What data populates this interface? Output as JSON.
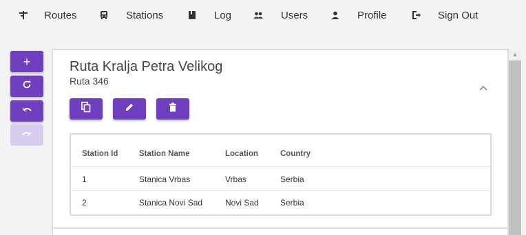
{
  "nav": {
    "routes": "Routes",
    "stations": "Stations",
    "log": "Log",
    "users": "Users",
    "profile": "Profile",
    "sign_out": "Sign Out"
  },
  "toolbar": {
    "add": "+",
    "refresh": "refresh-icon",
    "undo": "undo-icon",
    "redo": "redo-icon",
    "redo_enabled": false
  },
  "route": {
    "title": "Ruta Kralja Petra Velikog",
    "subtitle": "Ruta 346"
  },
  "table": {
    "headers": [
      "Station Id",
      "Station Name",
      "Location",
      "Country"
    ],
    "rows": [
      [
        "1",
        "Stanica Vrbas",
        "Vrbas",
        "Serbia"
      ],
      [
        "2",
        "Stanica Novi Sad",
        "Novi Sad",
        "Serbia"
      ]
    ]
  },
  "colors": {
    "accent": "#6f3fbf",
    "accent_disabled": "#d8cdee"
  }
}
